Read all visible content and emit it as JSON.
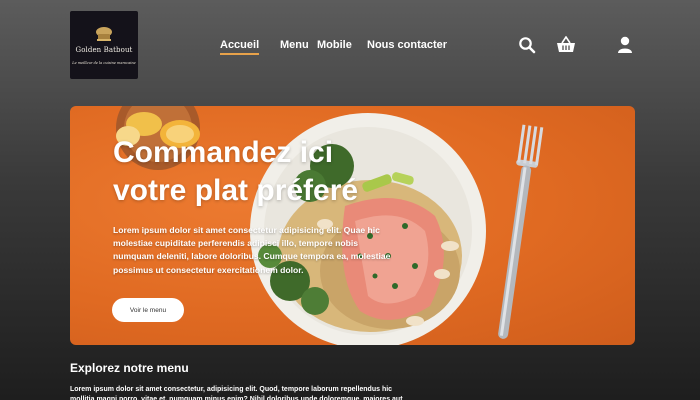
{
  "logo": {
    "name": "Golden Batbout",
    "tagline": "Le meilleur de la cuisine marocaine"
  },
  "nav": {
    "items": [
      "Accueil",
      "Menu",
      "Mobile",
      "Nous contacter"
    ],
    "active": "Accueil",
    "accent": "#e8a24a"
  },
  "icons": [
    "search-icon",
    "shopping-basket-icon",
    "user-icon"
  ],
  "hero": {
    "title_line1": "Commandez ici",
    "title_line2": "votre plat préferé",
    "text": "Lorem ipsum dolor sit amet consectetur adipisicing elit. Quae hic molestiae cupiditate perferendis adipisci illo, tempore nobis numquam deleniti, labore doloribus. Cumque tempora ea, molestiae possimus ut consectetur exercitationem dolor.",
    "button": "Voir le menu",
    "background": "#e06a22"
  },
  "menu_section": {
    "title": "Explorez notre menu",
    "text": "Lorem ipsum dolor sit amet consectetur, adipisicing elit. Quod, tempore laborum repellendus hic mollitia magni porro, vitae et, numquam minus enim? Nihil doloribus unde doloremque, maiores aut"
  }
}
